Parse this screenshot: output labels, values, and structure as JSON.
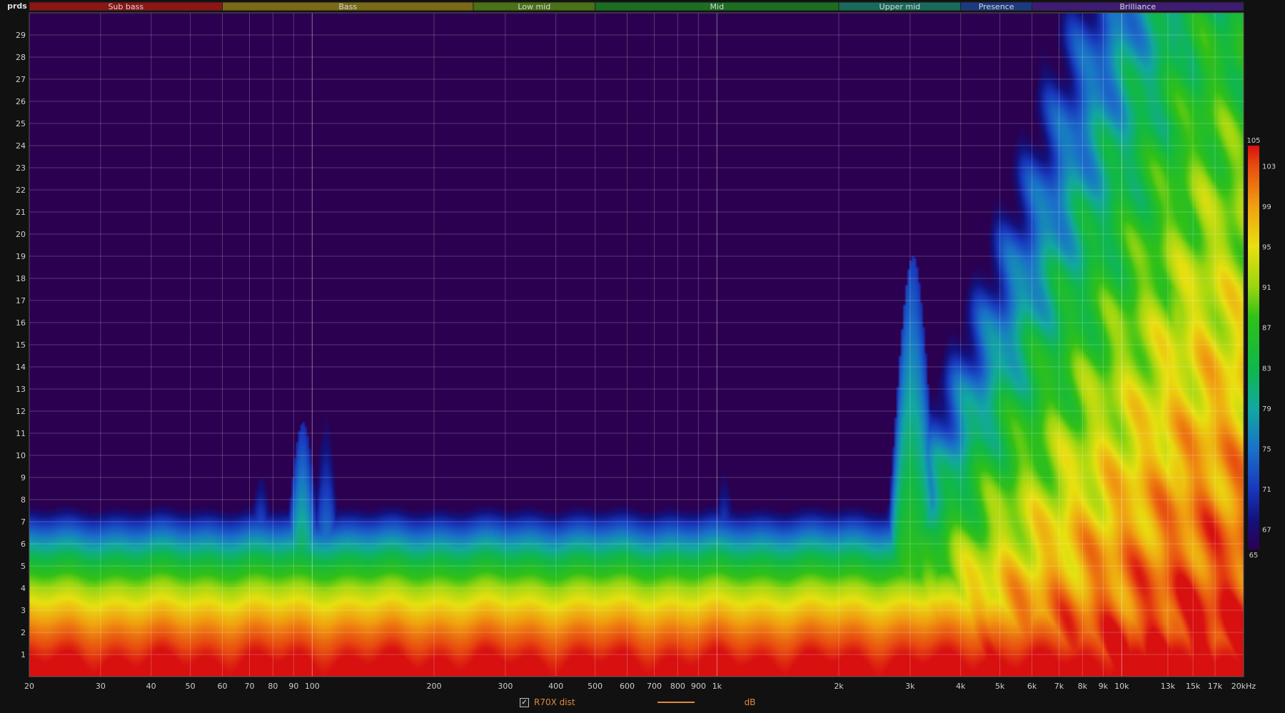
{
  "unit_label": "prds",
  "chart_data": {
    "type": "heatmap",
    "xscale": "log",
    "xlim": [
      20,
      20000
    ],
    "ylim": [
      0,
      30
    ],
    "grid": true,
    "x_ticks": [
      {
        "v": 20,
        "label": "20",
        "major": false
      },
      {
        "v": 30,
        "label": "30",
        "major": false
      },
      {
        "v": 40,
        "label": "40",
        "major": false
      },
      {
        "v": 50,
        "label": "50",
        "major": false
      },
      {
        "v": 60,
        "label": "60",
        "major": false
      },
      {
        "v": 70,
        "label": "70",
        "major": false
      },
      {
        "v": 80,
        "label": "80",
        "major": false
      },
      {
        "v": 90,
        "label": "90",
        "major": false
      },
      {
        "v": 100,
        "label": "100",
        "major": true
      },
      {
        "v": 200,
        "label": "200",
        "major": false
      },
      {
        "v": 300,
        "label": "300",
        "major": false
      },
      {
        "v": 400,
        "label": "400",
        "major": false
      },
      {
        "v": 500,
        "label": "500",
        "major": false
      },
      {
        "v": 600,
        "label": "600",
        "major": false
      },
      {
        "v": 700,
        "label": "700",
        "major": false
      },
      {
        "v": 800,
        "label": "800",
        "major": false
      },
      {
        "v": 900,
        "label": "900",
        "major": false
      },
      {
        "v": 1000,
        "label": "1k",
        "major": true
      },
      {
        "v": 2000,
        "label": "2k",
        "major": false
      },
      {
        "v": 3000,
        "label": "3k",
        "major": false
      },
      {
        "v": 4000,
        "label": "4k",
        "major": false
      },
      {
        "v": 5000,
        "label": "5k",
        "major": false
      },
      {
        "v": 6000,
        "label": "6k",
        "major": false
      },
      {
        "v": 7000,
        "label": "7k",
        "major": false
      },
      {
        "v": 8000,
        "label": "8k",
        "major": false
      },
      {
        "v": 9000,
        "label": "9k",
        "major": false
      },
      {
        "v": 10000,
        "label": "10k",
        "major": true
      },
      {
        "v": 13000,
        "label": "13k",
        "major": false
      },
      {
        "v": 15000,
        "label": "15k",
        "major": false
      },
      {
        "v": 17000,
        "label": "17k",
        "major": false
      },
      {
        "v": 20000,
        "label": "20kHz",
        "major": false
      }
    ],
    "y_ticks": [
      "1",
      "2",
      "3",
      "4",
      "5",
      "6",
      "7",
      "8",
      "9",
      "10",
      "11",
      "12",
      "13",
      "14",
      "15",
      "16",
      "17",
      "18",
      "19",
      "20",
      "21",
      "22",
      "23",
      "24",
      "25",
      "26",
      "27",
      "28",
      "29"
    ],
    "bands": [
      {
        "name": "Sub bass",
        "from": 20,
        "to": 60,
        "color": "#8a1616"
      },
      {
        "name": "Bass",
        "from": 60,
        "to": 250,
        "color": "#7a6a18"
      },
      {
        "name": "Low mid",
        "from": 250,
        "to": 500,
        "color": "#4a7216"
      },
      {
        "name": "Mid",
        "from": 500,
        "to": 2000,
        "color": "#1c6e22"
      },
      {
        "name": "Upper mid",
        "from": 2000,
        "to": 4000,
        "color": "#1a6a5c"
      },
      {
        "name": "Presence",
        "from": 4000,
        "to": 6000,
        "color": "#1c3a80"
      },
      {
        "name": "Brilliance",
        "from": 6000,
        "to": 20000,
        "color": "#3e1c72"
      }
    ],
    "colorbar": {
      "min": 65,
      "max": 105,
      "labels": [
        "105",
        "103",
        "99",
        "95",
        "91",
        "87",
        "83",
        "79",
        "75",
        "71",
        "67",
        "65"
      ],
      "stops": [
        {
          "v": 65,
          "color": "#2b0050"
        },
        {
          "v": 68,
          "color": "#12127e"
        },
        {
          "v": 71,
          "color": "#1838bc"
        },
        {
          "v": 75,
          "color": "#1a72c8"
        },
        {
          "v": 79,
          "color": "#12a8a0"
        },
        {
          "v": 83,
          "color": "#10b848"
        },
        {
          "v": 88,
          "color": "#30c018"
        },
        {
          "v": 91,
          "color": "#9ad610"
        },
        {
          "v": 95,
          "color": "#e8e010"
        },
        {
          "v": 99,
          "color": "#f0a010"
        },
        {
          "v": 103,
          "color": "#e84c10"
        },
        {
          "v": 105,
          "color": "#d81010"
        }
      ]
    },
    "features": {
      "base_ridge_db": 79,
      "base_ridge_period": 6.3,
      "bumps": [
        {
          "f": 75,
          "t": 8,
          "w": 0.05,
          "db": 82
        },
        {
          "f": 95,
          "t": 10.5,
          "w": 0.05,
          "db": 85
        },
        {
          "f": 108,
          "t": 12.5,
          "w": 0.04,
          "db": 80
        },
        {
          "f": 1050,
          "t": 8.5,
          "w": 0.05,
          "db": 80
        },
        {
          "f": 3050,
          "t": 18,
          "w": 0.06,
          "db": 86
        },
        {
          "f": 3200,
          "t": 25,
          "w": 0.03,
          "db": 70
        },
        {
          "f": 4200,
          "t": 12,
          "w": 0.05,
          "db": 84
        },
        {
          "f": 7000,
          "t": 13,
          "w": 0.06,
          "db": 84
        },
        {
          "f": 9500,
          "t": 18,
          "w": 0.06,
          "db": 88
        },
        {
          "f": 14500,
          "t": 30,
          "w": 0.12,
          "db": 94
        },
        {
          "f": 18500,
          "t": 30,
          "w": 0.06,
          "db": 92
        }
      ],
      "hot_region": {
        "from_hz": 2600,
        "peak_hz": 16000,
        "max_boost_db": 14
      }
    }
  },
  "legend": {
    "checked": true,
    "series_name": "R70X dist",
    "unit": "dB"
  }
}
